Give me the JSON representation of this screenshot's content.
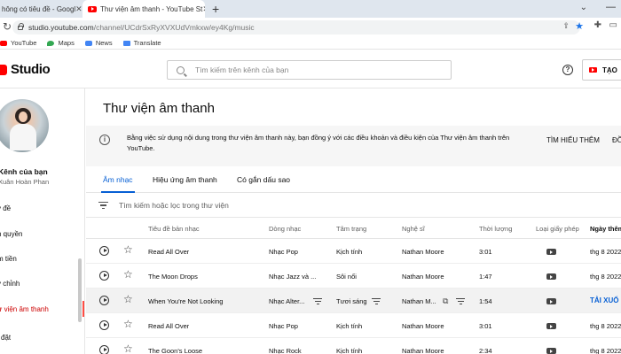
{
  "browser": {
    "tabs": [
      {
        "title": "hông có tiêu đề - Googl"
      },
      {
        "title": "Thư viện âm thanh - YouTube St"
      }
    ],
    "url_host": "studio.youtube.com",
    "url_path": "/channel/UCdrSxRyXVXUdVmkxw/ey4Kg/music",
    "bookmarks": [
      "YouTube",
      "Maps",
      "News",
      "Translate"
    ]
  },
  "header": {
    "logo_text": "Studio",
    "search_placeholder": "Tìm kiếm trên kênh của bạn",
    "create_label": "TẠO"
  },
  "sidebar": {
    "channel_title": "Kênh của bạn",
    "channel_name": "Xuân Hoàn Phan",
    "items": [
      {
        "label": "y đề"
      },
      {
        "label": "n quyền"
      },
      {
        "label": "m tiền"
      },
      {
        "label": "y chỉnh"
      },
      {
        "label": "ư viện âm thanh"
      },
      {
        "label": "i đặt"
      }
    ],
    "accent_color": "#ff4e45"
  },
  "main": {
    "title": "Thư viện âm thanh",
    "notice": "Bằng việc sử dụng nội dung trong thư viện âm thanh này, bạn đồng ý với các điều khoản và điều kiện của Thư viện âm thanh trên YouTube.",
    "learn_more": "TÌM HIỂU THÊM",
    "agree": "ĐỒ",
    "tabs": [
      {
        "label": "Âm nhạc"
      },
      {
        "label": "Hiệu ứng âm thanh"
      },
      {
        "label": "Có gắn dấu sao"
      }
    ],
    "filter_placeholder": "Tìm kiếm hoặc lọc trong thư viện",
    "columns": {
      "title": "Tiêu đề bản nhạc",
      "genre": "Dòng nhạc",
      "mood": "Tâm trạng",
      "artist": "Nghệ sĩ",
      "duration": "Thời lượng",
      "license": "Loại giấy phép",
      "date": "Ngày thêm"
    },
    "rows": [
      {
        "title": "Read All Over",
        "genre": "Nhạc Pop",
        "mood": "Kịch tính",
        "artist": "Nathan Moore",
        "duration": "3:01",
        "date": "thg 8 2022"
      },
      {
        "title": "The Moon Drops",
        "genre": "Nhạc Jazz và ...",
        "mood": "Sôi nổi",
        "artist": "Nathan Moore",
        "duration": "1:47",
        "date": "thg 8 2022"
      },
      {
        "title": "When You're Not Looking",
        "genre": "Nhạc Alter...",
        "mood": "Tươi sáng",
        "artist": "Nathan M...",
        "duration": "1:54",
        "date": "TẢI XUỐ"
      },
      {
        "title": "Read All Over",
        "genre": "Nhạc Pop",
        "mood": "Kịch tính",
        "artist": "Nathan Moore",
        "duration": "3:01",
        "date": "thg 8 2022"
      },
      {
        "title": "The Goon's Loose",
        "genre": "Nhạc Rock",
        "mood": "Kịch tính",
        "artist": "Nathan Moore",
        "duration": "2:34",
        "date": "thg 8 2022"
      }
    ],
    "link_color": "#065fd4"
  }
}
